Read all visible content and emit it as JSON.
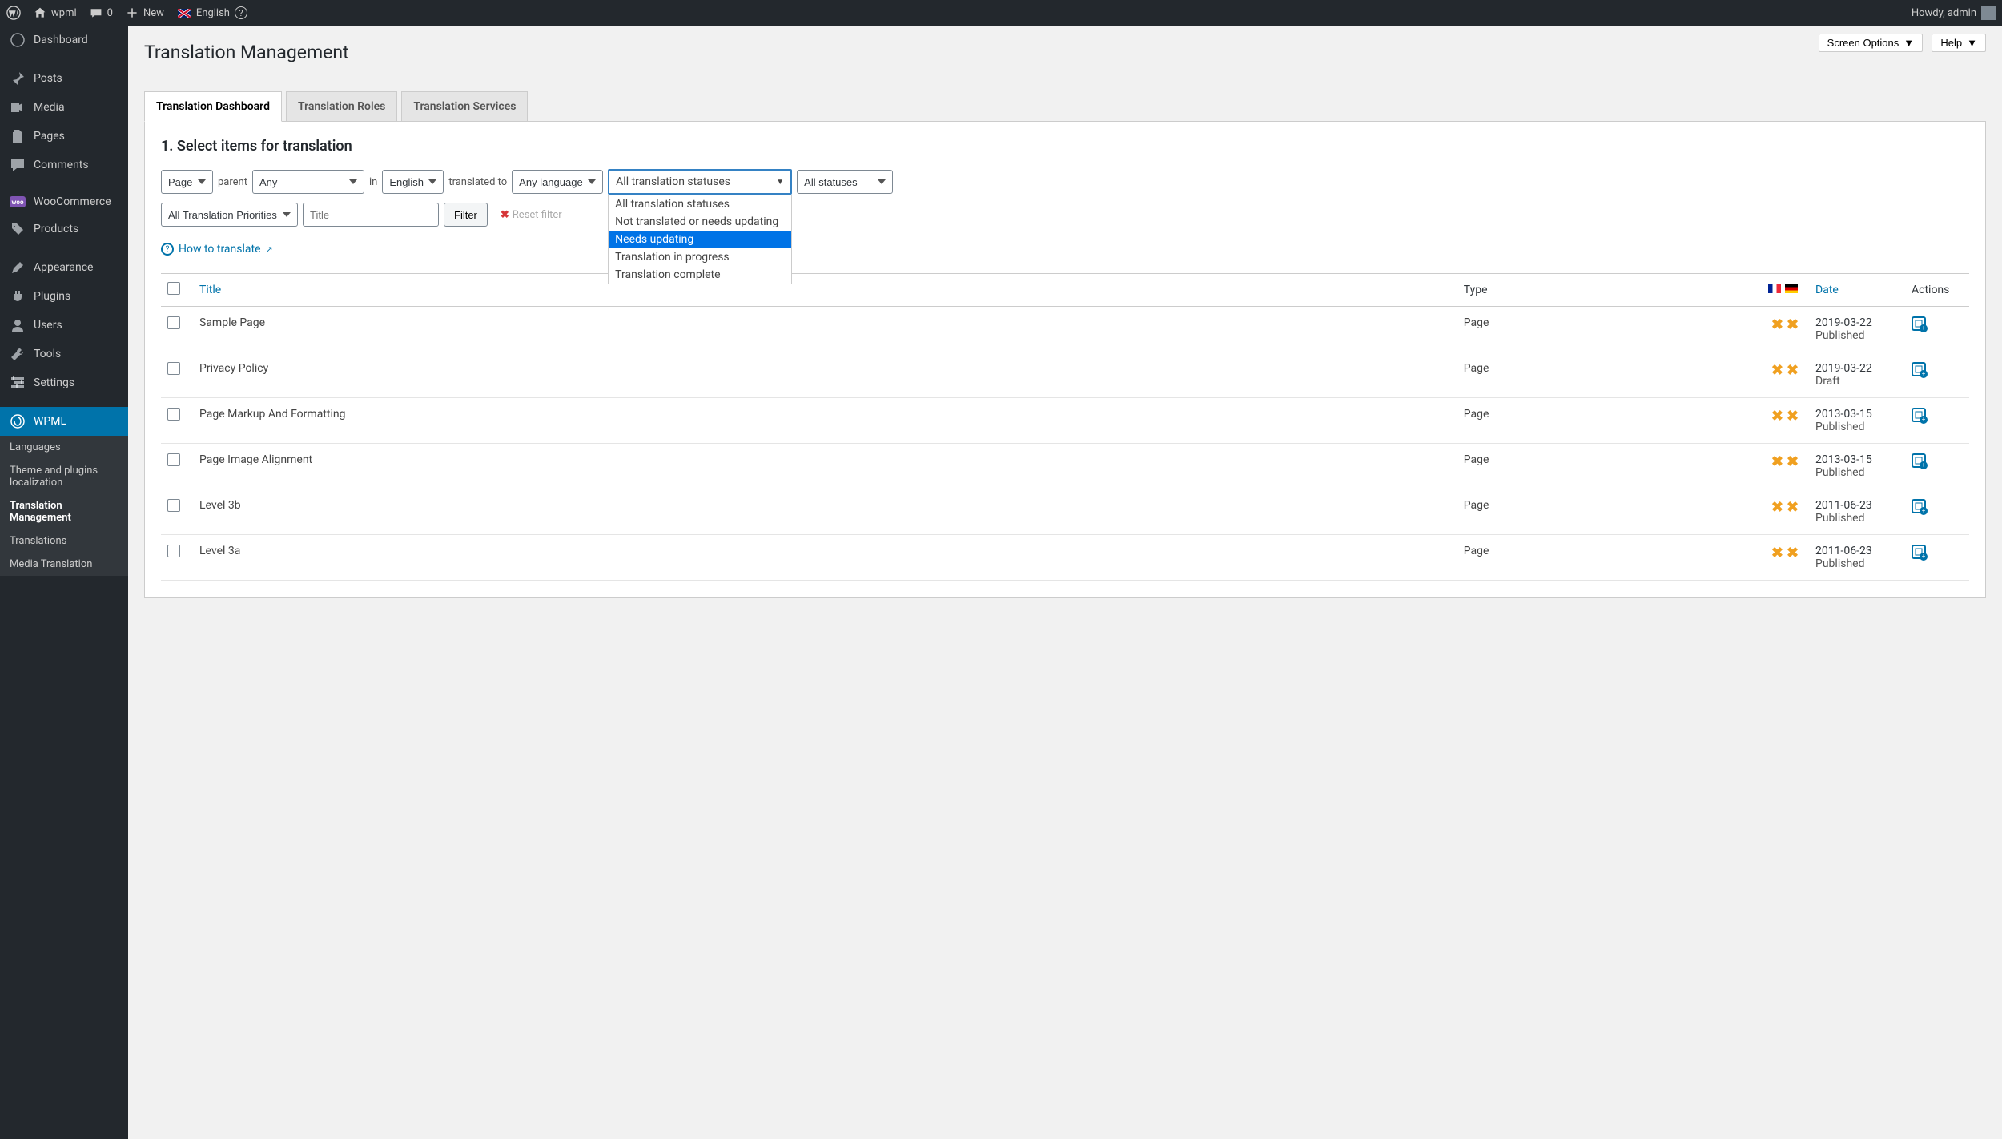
{
  "topbar": {
    "site_name": "wpml",
    "comments_count": "0",
    "new_label": "New",
    "language": "English",
    "greeting": "Howdy, admin"
  },
  "sidebar": {
    "items": [
      {
        "label": "Dashboard",
        "icon": "dashboard"
      },
      {
        "label": "Posts",
        "icon": "pin"
      },
      {
        "label": "Media",
        "icon": "media"
      },
      {
        "label": "Pages",
        "icon": "pages"
      },
      {
        "label": "Comments",
        "icon": "comment"
      },
      {
        "label": "WooCommerce",
        "icon": "woo"
      },
      {
        "label": "Products",
        "icon": "products"
      },
      {
        "label": "Appearance",
        "icon": "appearance"
      },
      {
        "label": "Plugins",
        "icon": "plugins"
      },
      {
        "label": "Users",
        "icon": "users"
      },
      {
        "label": "Tools",
        "icon": "tools"
      },
      {
        "label": "Settings",
        "icon": "settings"
      },
      {
        "label": "WPML",
        "icon": "wpml",
        "current": true
      }
    ],
    "sub_items": [
      {
        "label": "Languages"
      },
      {
        "label": "Theme and plugins localization"
      },
      {
        "label": "Translation Management",
        "active": true
      },
      {
        "label": "Translations"
      },
      {
        "label": "Media Translation"
      }
    ]
  },
  "top_actions": {
    "screen_options": "Screen Options",
    "help": "Help"
  },
  "page": {
    "title": "Translation Management",
    "tabs": [
      "Translation Dashboard",
      "Translation Roles",
      "Translation Services"
    ],
    "section_heading": "1. Select items for translation"
  },
  "filters": {
    "post_type": "Page",
    "parent_label": "parent",
    "parent_value": "Any",
    "in_label": "in",
    "language": "English",
    "translated_to_label": "translated to",
    "target_lang": "Any language",
    "translation_status_selected": "All translation statuses",
    "translation_status_options": [
      "All translation statuses",
      "Not translated or needs updating",
      "Needs updating",
      "Translation in progress",
      "Translation complete"
    ],
    "translation_status_highlighted_index": 2,
    "publish_status": "All statuses",
    "priority": "All Translation Priorities",
    "title_placeholder": "Title",
    "filter_btn": "Filter",
    "reset_filter": "Reset filter",
    "how_to_translate": "How to translate"
  },
  "table": {
    "headers": {
      "title": "Title",
      "type": "Type",
      "date": "Date",
      "actions": "Actions"
    },
    "rows": [
      {
        "title": "Sample Page",
        "type": "Page",
        "date": "2019-03-22",
        "status": "Published"
      },
      {
        "title": "Privacy Policy",
        "type": "Page",
        "date": "2019-03-22",
        "status": "Draft"
      },
      {
        "title": "Page Markup And Formatting",
        "type": "Page",
        "date": "2013-03-15",
        "status": "Published"
      },
      {
        "title": "Page Image Alignment",
        "type": "Page",
        "date": "2013-03-15",
        "status": "Published"
      },
      {
        "title": "Level 3b",
        "type": "Page",
        "date": "2011-06-23",
        "status": "Published"
      },
      {
        "title": "Level 3a",
        "type": "Page",
        "date": "2011-06-23",
        "status": "Published"
      }
    ]
  }
}
